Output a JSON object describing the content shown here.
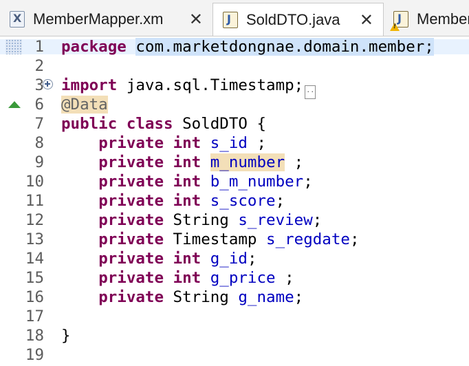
{
  "tabs": [
    {
      "label": "MemberMapper.xm",
      "icon": "xml-file-icon",
      "close": "✕"
    },
    {
      "label": "SoldDTO.java",
      "icon": "java-file-icon",
      "close": "✕",
      "active": true
    },
    {
      "label": "Member",
      "icon": "java-file-warning-icon"
    }
  ],
  "icon_glyphs": {
    "xml": "X",
    "java": "J"
  },
  "colors": {
    "keyword": "#7f0055",
    "field": "#0000c0",
    "annotation": "#646464",
    "selection": "#cfe3fa",
    "occurrence": "#f3dfb8"
  },
  "editor": {
    "folded_marker": "..",
    "lines": [
      {
        "no": "1",
        "tokens": [
          {
            "t": "package",
            "k": "kw"
          },
          {
            "t": " "
          },
          {
            "t": "com.marketdongnae.domain.member;",
            "k": "sel"
          }
        ]
      },
      {
        "no": "2",
        "tokens": []
      },
      {
        "no": "3",
        "tokens": [
          {
            "t": "import",
            "k": "kw"
          },
          {
            "t": " java.sql.Timestamp;"
          }
        ],
        "fold": true
      },
      {
        "no": "6",
        "tokens": [
          {
            "t": "@Data",
            "k": "ann occ"
          }
        ],
        "override": true
      },
      {
        "no": "7",
        "tokens": [
          {
            "t": "public",
            "k": "kw"
          },
          {
            "t": " "
          },
          {
            "t": "class",
            "k": "kw"
          },
          {
            "t": " SoldDTO {"
          }
        ]
      },
      {
        "no": "8",
        "tokens": [
          {
            "t": "    "
          },
          {
            "t": "private",
            "k": "kw"
          },
          {
            "t": " "
          },
          {
            "t": "int",
            "k": "kw"
          },
          {
            "t": " "
          },
          {
            "t": "s_id",
            "k": "fld"
          },
          {
            "t": " ;"
          }
        ]
      },
      {
        "no": "9",
        "tokens": [
          {
            "t": "    "
          },
          {
            "t": "private",
            "k": "kw"
          },
          {
            "t": " "
          },
          {
            "t": "int",
            "k": "kw"
          },
          {
            "t": " "
          },
          {
            "t": "m_number",
            "k": "fld occ"
          },
          {
            "t": " ;"
          }
        ]
      },
      {
        "no": "10",
        "tokens": [
          {
            "t": "    "
          },
          {
            "t": "private",
            "k": "kw"
          },
          {
            "t": " "
          },
          {
            "t": "int",
            "k": "kw"
          },
          {
            "t": " "
          },
          {
            "t": "b_m_number",
            "k": "fld"
          },
          {
            "t": ";"
          }
        ]
      },
      {
        "no": "11",
        "tokens": [
          {
            "t": "    "
          },
          {
            "t": "private",
            "k": "kw"
          },
          {
            "t": " "
          },
          {
            "t": "int",
            "k": "kw"
          },
          {
            "t": " "
          },
          {
            "t": "s_score",
            "k": "fld"
          },
          {
            "t": ";"
          }
        ]
      },
      {
        "no": "12",
        "tokens": [
          {
            "t": "    "
          },
          {
            "t": "private",
            "k": "kw"
          },
          {
            "t": " String "
          },
          {
            "t": "s_review",
            "k": "fld"
          },
          {
            "t": ";"
          }
        ]
      },
      {
        "no": "13",
        "tokens": [
          {
            "t": "    "
          },
          {
            "t": "private",
            "k": "kw"
          },
          {
            "t": " Timestamp "
          },
          {
            "t": "s_regdate",
            "k": "fld"
          },
          {
            "t": ";"
          }
        ]
      },
      {
        "no": "14",
        "tokens": [
          {
            "t": "    "
          },
          {
            "t": "private",
            "k": "kw"
          },
          {
            "t": " "
          },
          {
            "t": "int",
            "k": "kw"
          },
          {
            "t": " "
          },
          {
            "t": "g_id",
            "k": "fld"
          },
          {
            "t": ";"
          }
        ]
      },
      {
        "no": "15",
        "tokens": [
          {
            "t": "    "
          },
          {
            "t": "private",
            "k": "kw"
          },
          {
            "t": " "
          },
          {
            "t": "int",
            "k": "kw"
          },
          {
            "t": " "
          },
          {
            "t": "g_price",
            "k": "fld"
          },
          {
            "t": " ;"
          }
        ]
      },
      {
        "no": "16",
        "tokens": [
          {
            "t": "    "
          },
          {
            "t": "private",
            "k": "kw"
          },
          {
            "t": " String "
          },
          {
            "t": "g_name",
            "k": "fld"
          },
          {
            "t": ";"
          }
        ]
      },
      {
        "no": "17",
        "tokens": []
      },
      {
        "no": "18",
        "tokens": [
          {
            "t": "}"
          }
        ]
      },
      {
        "no": "19",
        "tokens": []
      }
    ]
  }
}
